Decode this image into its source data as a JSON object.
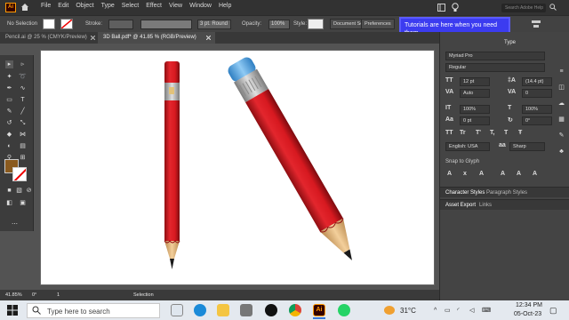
{
  "menubar": {
    "app_logo": "Ai",
    "menus": [
      "File",
      "Edit",
      "Object",
      "Type",
      "Select",
      "Effect",
      "View",
      "Window",
      "Help"
    ],
    "search_placeholder": "Search Adobe Help"
  },
  "control_bar": {
    "selection": "No Selection",
    "stroke_label": "Stroke:",
    "brush": "3 pt. Round",
    "opacity_label": "Opacity:",
    "opacity_value": "100%",
    "style_label": "Style:",
    "document_setup": "Document Setup",
    "preferences": "Preferences"
  },
  "tooltip": {
    "text": "Tutorials are here when you need them."
  },
  "tabs": [
    {
      "label": "Pencil.ai @ 25 % (CMYK/Preview)",
      "active": false
    },
    {
      "label": "3D Ball.pdf* @ 41.85 % (RGB/Preview)",
      "active": true
    }
  ],
  "status_bar": {
    "zoom": "41.85%",
    "rotation": "0°",
    "artboard": "1",
    "tool": "Selection"
  },
  "character_panel": {
    "header": "Type",
    "font_family": "Myriad Pro",
    "font_style": "Regular",
    "font_size": "12 pt",
    "leading": "(14.4 pt)",
    "kerning": "Auto",
    "tracking": "0",
    "vertical_scale": "100%",
    "horizontal_scale": "100%",
    "baseline_shift": "0 pt",
    "rotation": "0°",
    "tt_buttons": [
      "TT",
      "Tr",
      "T'",
      "T,",
      "T",
      "Ŧ"
    ],
    "language": "English: USA",
    "anti_alias": "Sharp",
    "snap_label": "Snap to Glyph"
  },
  "panel_tabs": {
    "group1": [
      "Character Styles",
      "Paragraph Styles"
    ],
    "group2": [
      "Asset Export",
      "Links"
    ]
  },
  "taskbar": {
    "search_placeholder": "Type here to search",
    "temperature": "31°C",
    "time": "12:34 PM",
    "date": "05-Oct-23"
  },
  "colors": {
    "pencil_red": "#d71920",
    "eraser_blue": "#5aa9e6",
    "ferrule_gray": "#b5b5b5",
    "wood": "#e7b77a",
    "tooltip_blue": "#3c3cf0",
    "swatch_brown": "#8a5a1e"
  },
  "icons": [
    "home-icon",
    "lightbulb-icon",
    "search-icon",
    "windows-icon",
    "edge-icon",
    "chrome-icon",
    "illustrator-icon",
    "whatsapp-icon"
  ]
}
